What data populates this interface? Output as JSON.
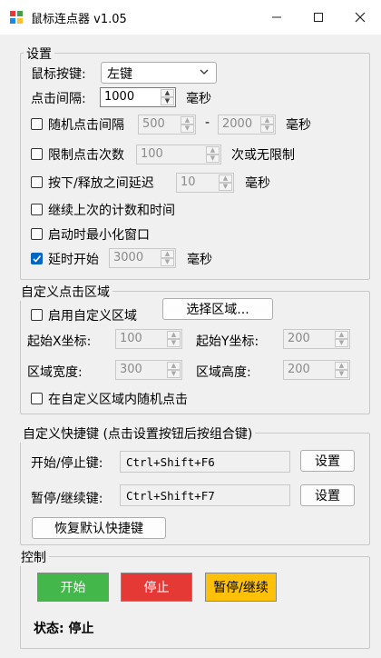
{
  "window": {
    "title": "鼠标连点器 v1.05",
    "min_icon": "minimize-icon",
    "max_icon": "maximize-icon",
    "close_icon": "close-icon"
  },
  "settings": {
    "group_title": "设置",
    "mouse_button_label": "鼠标按键:",
    "mouse_button_value": "左键",
    "interval_label": "点击间隔:",
    "interval_value": "1000",
    "interval_unit": "毫秒",
    "random_interval": {
      "label": "随机点击间隔",
      "checked": false,
      "min": "500",
      "dash": "-",
      "max": "2000",
      "unit": "毫秒"
    },
    "limit_clicks": {
      "label": "限制点击次数",
      "checked": false,
      "value": "100",
      "suffix": "次或无限制"
    },
    "press_release_delay": {
      "label": "按下/释放之间延迟",
      "checked": false,
      "value": "10",
      "unit": "毫秒"
    },
    "continue_last": {
      "label": "继续上次的计数和时间",
      "checked": false
    },
    "minimize_on_start": {
      "label": "启动时最小化窗口",
      "checked": false
    },
    "delayed_start": {
      "label": "延时开始",
      "checked": true,
      "value": "3000",
      "unit": "毫秒"
    }
  },
  "region": {
    "group_title": "自定义点击区域",
    "enable_label": "启用自定义区域",
    "enable_checked": false,
    "select_button": "选择区域...",
    "start_x_label": "起始X坐标:",
    "start_x_value": "100",
    "start_y_label": "起始Y坐标:",
    "start_y_value": "200",
    "width_label": "区域宽度:",
    "width_value": "300",
    "height_label": "区域高度:",
    "height_value": "200",
    "random_in_region_label": "在自定义区域内随机点击",
    "random_in_region_checked": false
  },
  "hotkeys": {
    "group_title": "自定义快捷键 (点击设置按钮后按组合键)",
    "start_stop_label": "开始/停止键:",
    "start_stop_value": "Ctrl+Shift+F6",
    "pause_resume_label": "暂停/继续键:",
    "pause_resume_value": "Ctrl+Shift+F7",
    "set_button": "设置",
    "restore_button": "恢复默认快捷键"
  },
  "control": {
    "group_title": "控制",
    "start_button": "开始",
    "stop_button": "停止",
    "pause_button": "暂停/继续",
    "status_text": "状态: 停止",
    "colors": {
      "start": "#43b74a",
      "stop": "#e53935",
      "pause": "#ffc107"
    }
  }
}
